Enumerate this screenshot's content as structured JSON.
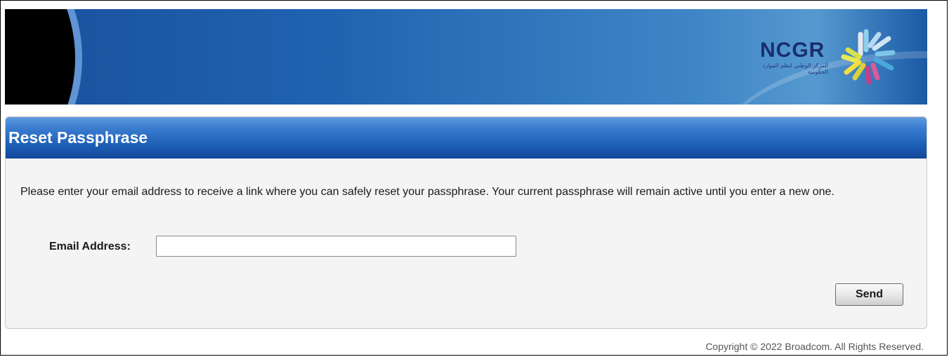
{
  "banner": {
    "logo_text": "NCGR",
    "logo_arabic": "المركز الوطني لنظم الموارد الحكومية",
    "logo_mark": "ncgr-star-logo"
  },
  "panel": {
    "title": "Reset Passphrase",
    "instructions": "Please enter your email address to receive a link where you can safely reset your passphrase. Your current passphrase will remain active until you enter a new one.",
    "email_label": "Email Address:",
    "email_value": "",
    "email_placeholder": "",
    "send_label": "Send"
  },
  "footer": {
    "copyright": "Copyright © 2022 Broadcom. All Rights Reserved."
  },
  "colors": {
    "header_blue": "#1b5db4",
    "banner_blue": "#1f63b0",
    "panel_bg": "#f4f4f4"
  }
}
